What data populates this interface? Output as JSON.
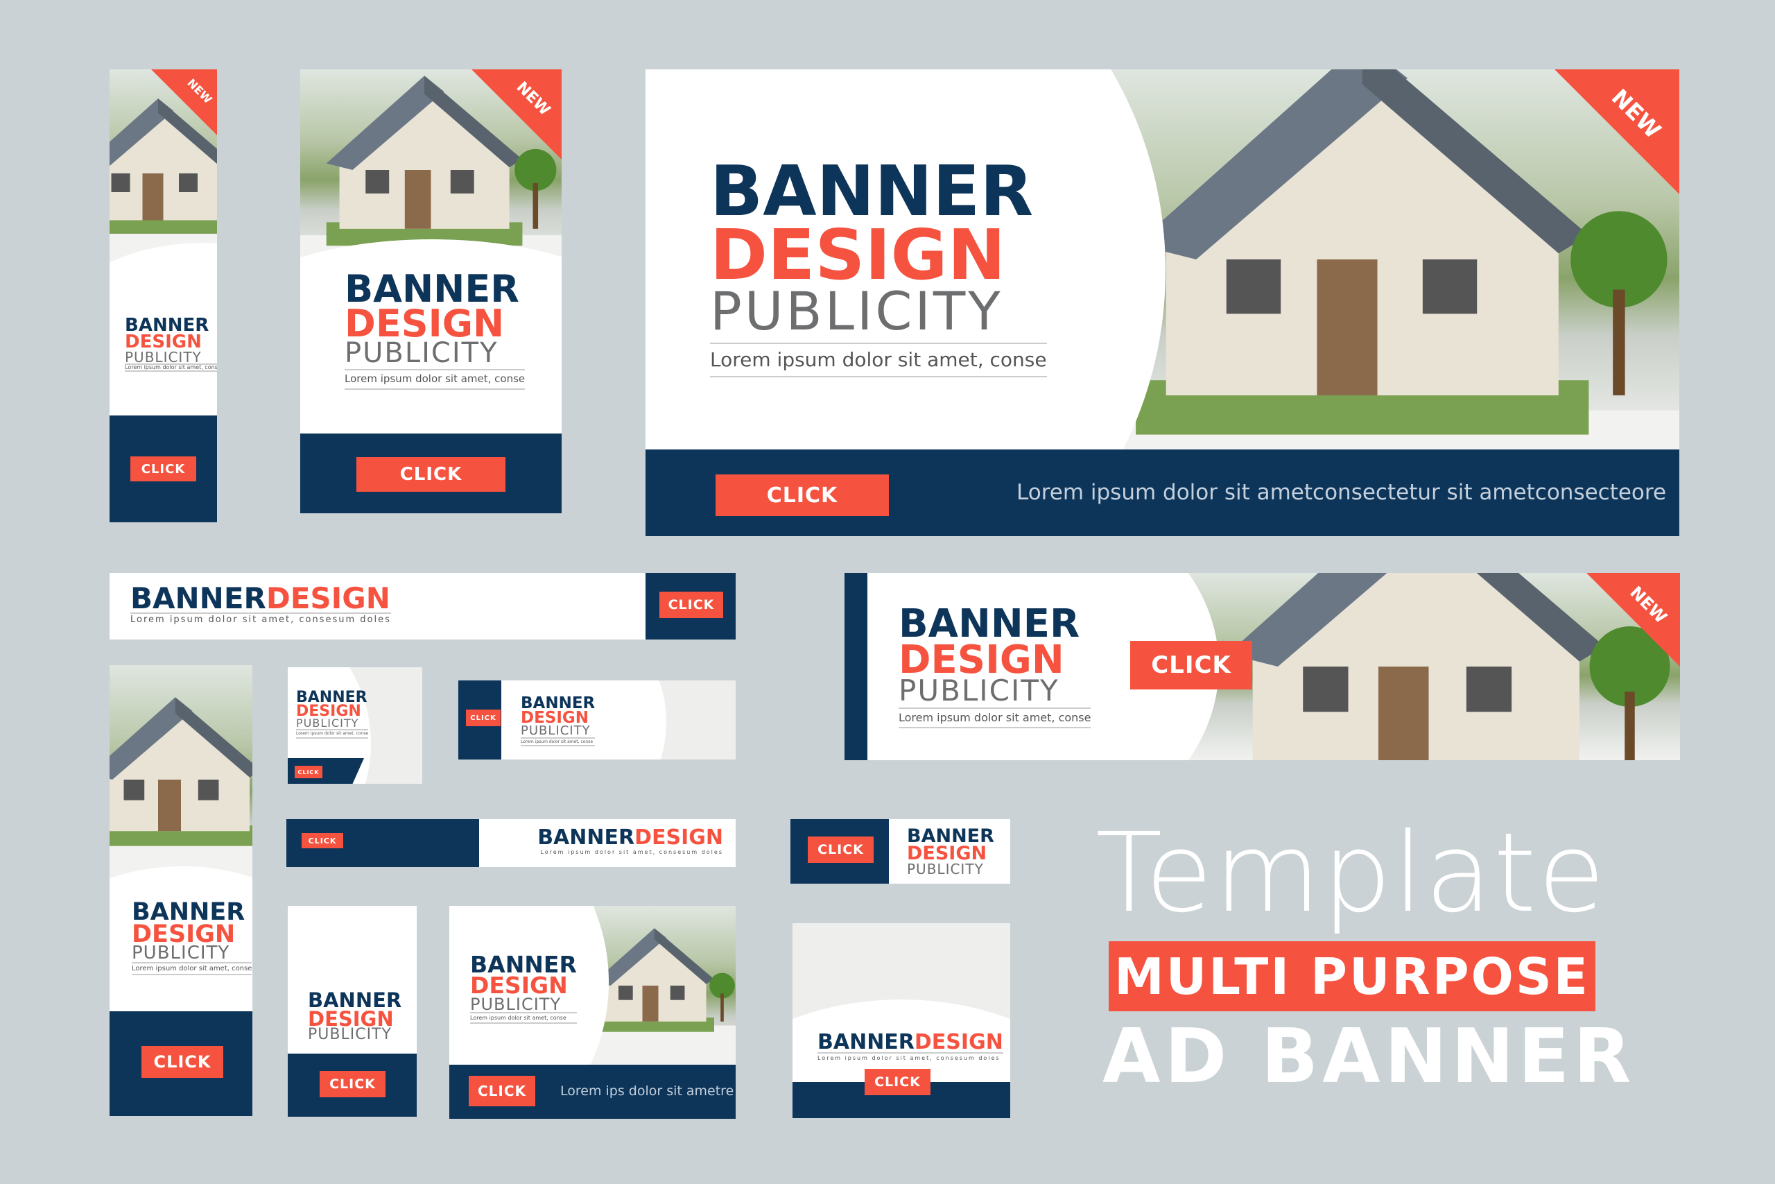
{
  "colors": {
    "navy": "#0d3459",
    "coral": "#f5533f",
    "background": "#cad2d5"
  },
  "brand": {
    "line1": "BANNER",
    "line2": "DESIGN",
    "line3": "PUBLICITY",
    "tagline": "Lorem ipsum dolor sit amet, conse",
    "tagline_long": "Lorem ipsum dolor sit amet, consesum doles"
  },
  "badge": "NEW",
  "click": "CLICK",
  "big_banner": {
    "footer_text": "Lorem ipsum dolor sit ametconsectetur sit ametconsecteore"
  },
  "rect_banner": {
    "footer_text": "Lorem ips dolor sit ametre"
  },
  "headline": {
    "template": "Template",
    "multi": "MULTI PURPOSE",
    "ad": "AD BANNER"
  }
}
